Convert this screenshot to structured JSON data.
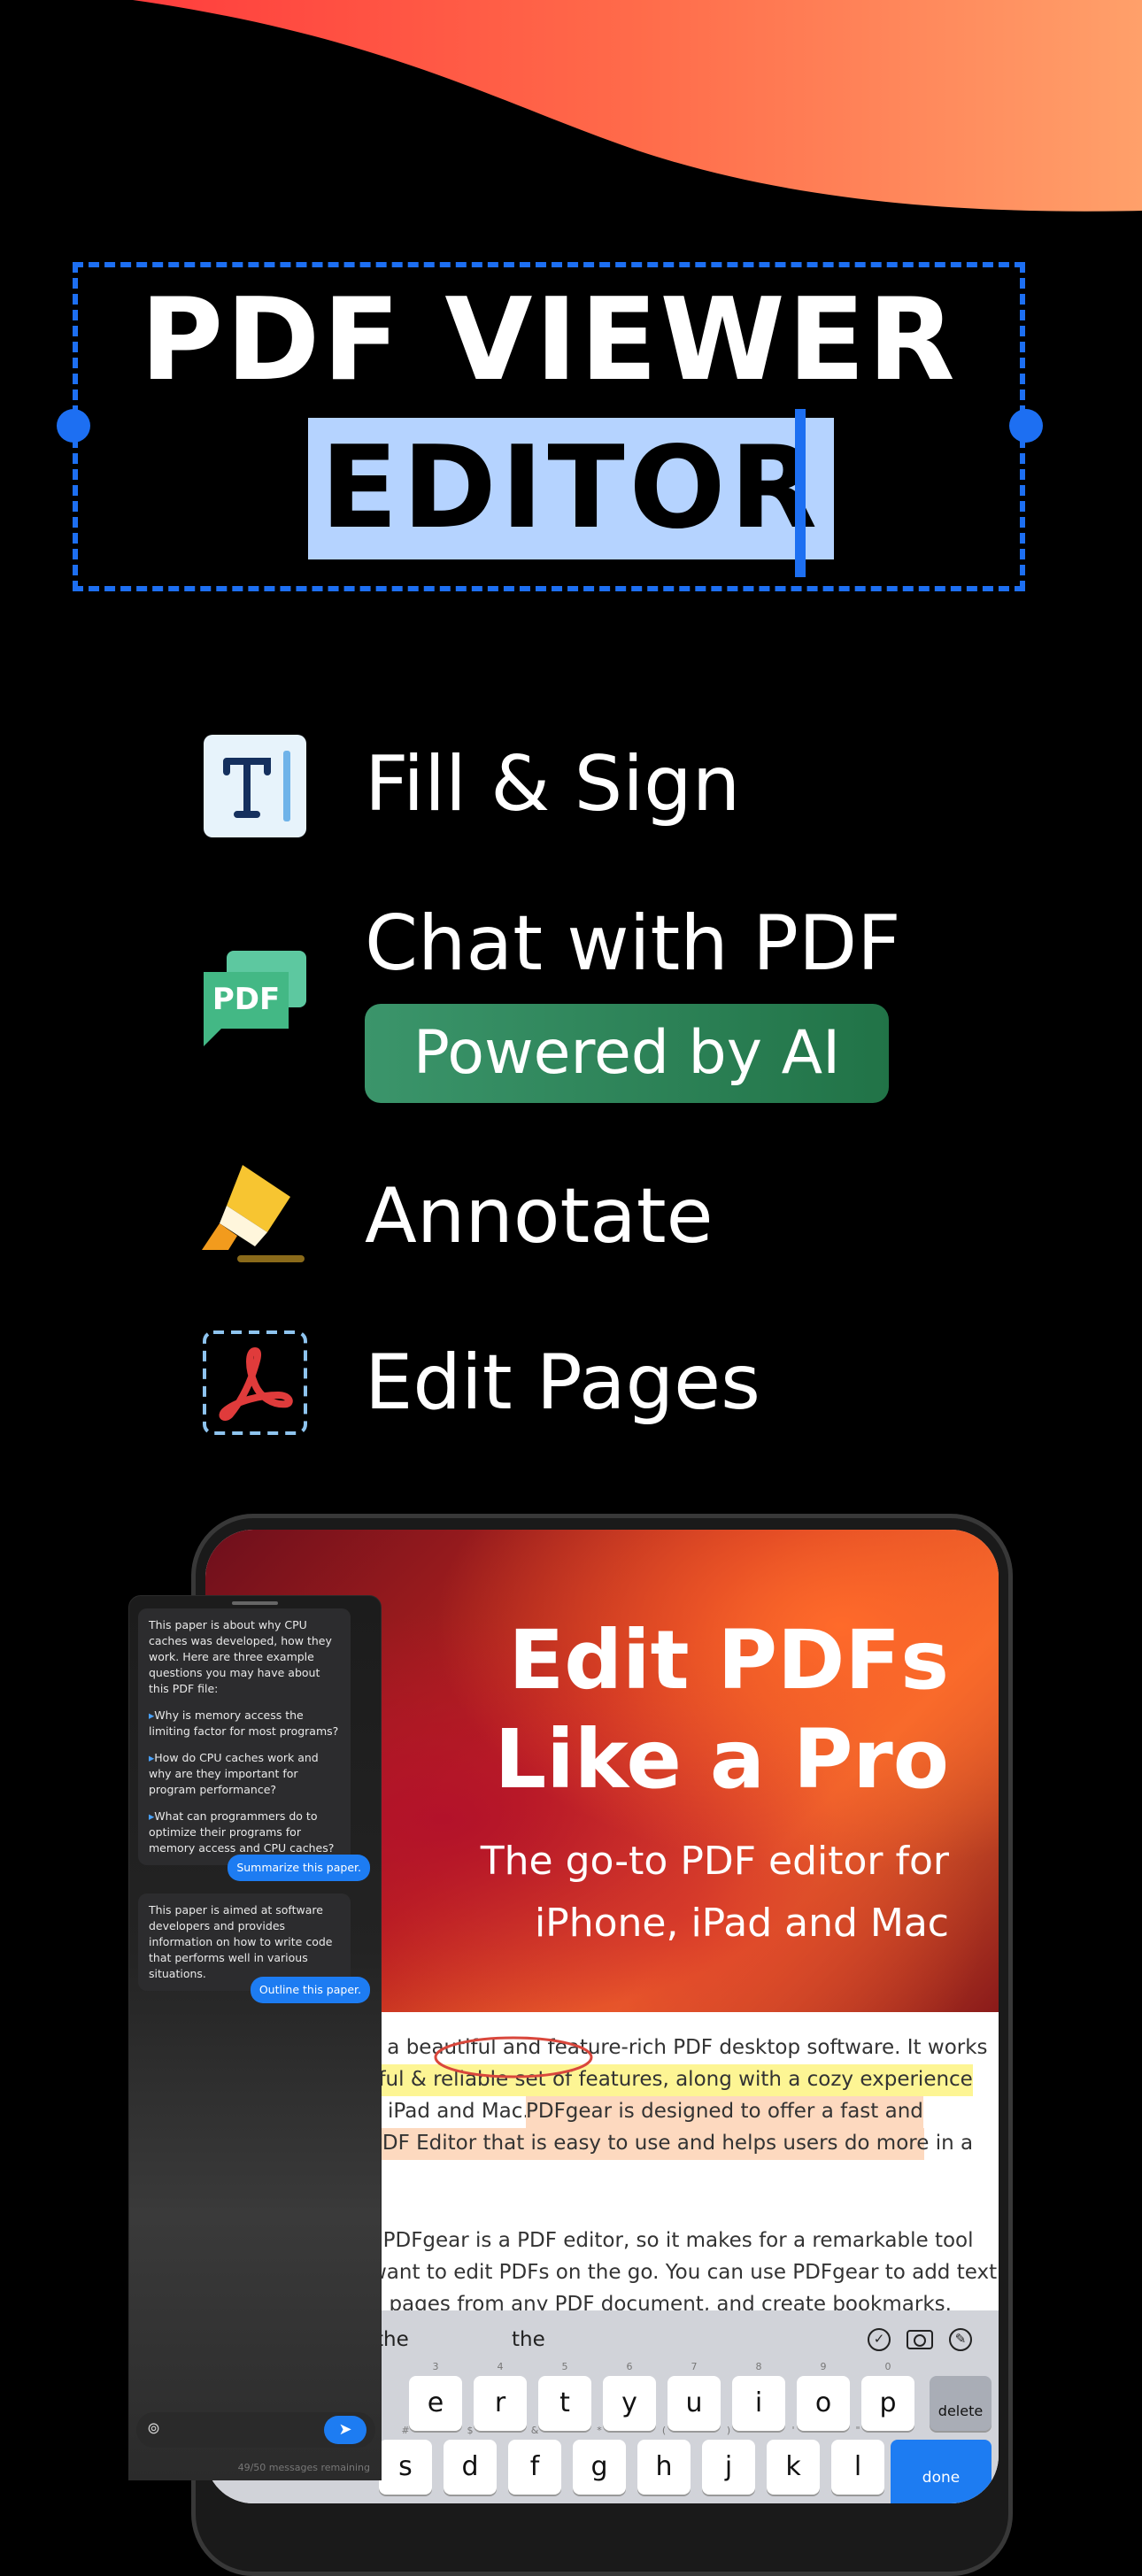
{
  "hero": {
    "title_line1": "PDF VIEWER &",
    "title_line2": "EDITOR"
  },
  "features": [
    {
      "label": "Fill & Sign",
      "icon": "text-cursor-icon"
    },
    {
      "label": "Chat with PDF",
      "icon": "pdf-chat-icon",
      "badge": "Powered by AI"
    },
    {
      "label": "Annotate",
      "icon": "highlighter-icon"
    },
    {
      "label": "Edit Pages",
      "icon": "acrobat-page-icon"
    }
  ],
  "device": {
    "banner_title_line1": "Edit PDFs",
    "banner_title_line2": "Like a Pro",
    "banner_sub_line1": "The go-to PDF editor for",
    "banner_sub_line2": "iPhone, iPad and Mac",
    "doc_lines": [
      "s a beautiful and feature-rich PDF desktop software. It works",
      "rful & reliable set of features, along with a cozy experience",
      "iPad and Mac.",
      "PDFgear is designed to offer a fast and",
      "PDF Editor that is easy to use and helps users do more in a",
      ".",
      ", PDFgear is a PDF editor, so it makes for a remarkable tool",
      "want to edit PDFs on the go. You can use PDFgear to add text",
      "e pages from any PDF document,  and create bookmarks."
    ],
    "keyboard": {
      "suggestions": [
        "the",
        "the",
        "the"
      ],
      "row1": [
        "e",
        "r",
        "t",
        "y",
        "u",
        "i",
        "o",
        "p"
      ],
      "row1_hints": [
        "3",
        "4",
        "5",
        "6",
        "7",
        "8",
        "9",
        "0"
      ],
      "delete": "delete",
      "row2": [
        "s",
        "d",
        "f",
        "g",
        "h",
        "j",
        "k",
        "l"
      ],
      "row2_hints": [
        "#",
        "$",
        "&",
        "*",
        "(",
        ")",
        "'",
        "\""
      ],
      "done": "done"
    }
  },
  "chat": {
    "intro": "This paper is about why CPU caches was developed, how they work. Here are three example questions you may have about this PDF file:",
    "questions": [
      "Why is memory access the limiting factor for most programs?",
      "How do CPU caches work and why are they important for program performance?",
      "What can programmers do to optimize their programs for memory access and CPU caches?"
    ],
    "user_msg1": "Summarize this paper.",
    "reply1": "This paper is aimed at software developers and provides information on how to write code that performs well in various situations.",
    "user_msg2": "Outline this paper.",
    "remaining": "49/50 messages remaining"
  },
  "colors": {
    "accent_blue": "#1d6ff2",
    "selection": "#b5d3ff",
    "ai_green": "#2f8a5c",
    "wave_orange": "#ff7a45"
  }
}
